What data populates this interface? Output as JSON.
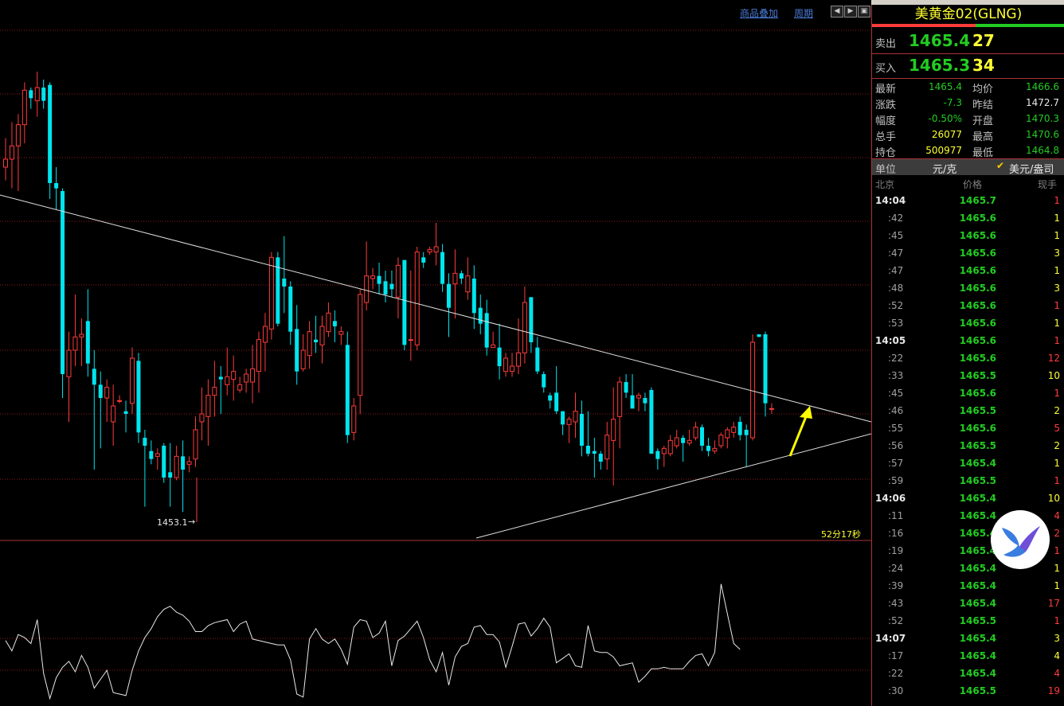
{
  "toolbar": {
    "overlay_label": "商品叠加",
    "period_label": "周期"
  },
  "chart": {
    "low_label": "1453.1",
    "countdown": "52分17秒"
  },
  "quote": {
    "title": "美黄金02(GLNG)",
    "sell_label": "卖出",
    "sell_price": "1465.4",
    "sell_qty": "27",
    "buy_label": "买入",
    "buy_price": "1465.3",
    "buy_qty": "34",
    "rows": [
      {
        "l1": "最新",
        "v1": "1465.4",
        "l2": "均价",
        "v2": "1466.6"
      },
      {
        "l1": "涨跌",
        "v1": "-7.3",
        "l2": "昨结",
        "v2": "1472.7"
      },
      {
        "l1": "幅度",
        "v1": "-0.50%",
        "l2": "开盘",
        "v2": "1470.3"
      },
      {
        "l1": "总手",
        "v1": "26077",
        "l2": "最高",
        "v2": "1470.6"
      },
      {
        "l1": "持仓",
        "v1": "500977",
        "l2": "最低",
        "v2": "1464.8"
      }
    ],
    "unit_label": "单位",
    "unit_value": "元/克",
    "unit_alt": "美元/盎司",
    "col_time": "北京",
    "col_price": "价格",
    "col_vol": "现手",
    "ticks": [
      {
        "t": "14:04",
        "p": "1465.7",
        "v": "1",
        "vc": "red",
        "major": true
      },
      {
        "t": ":42",
        "p": "1465.6",
        "v": "1",
        "vc": "yellow"
      },
      {
        "t": ":45",
        "p": "1465.6",
        "v": "1",
        "vc": "yellow"
      },
      {
        "t": ":47",
        "p": "1465.6",
        "v": "3",
        "vc": "yellow"
      },
      {
        "t": ":47",
        "p": "1465.6",
        "v": "1",
        "vc": "yellow"
      },
      {
        "t": ":48",
        "p": "1465.6",
        "v": "3",
        "vc": "yellow"
      },
      {
        "t": ":52",
        "p": "1465.6",
        "v": "1",
        "vc": "red"
      },
      {
        "t": ":53",
        "p": "1465.6",
        "v": "1",
        "vc": "yellow"
      },
      {
        "t": "14:05",
        "p": "1465.6",
        "v": "1",
        "vc": "red",
        "major": true
      },
      {
        "t": ":22",
        "p": "1465.6",
        "v": "12",
        "vc": "red"
      },
      {
        "t": ":33",
        "p": "1465.5",
        "v": "10",
        "vc": "yellow"
      },
      {
        "t": ":45",
        "p": "1465.6",
        "v": "1",
        "vc": "red"
      },
      {
        "t": ":46",
        "p": "1465.5",
        "v": "2",
        "vc": "yellow"
      },
      {
        "t": ":55",
        "p": "1465.6",
        "v": "5",
        "vc": "red"
      },
      {
        "t": ":56",
        "p": "1465.5",
        "v": "2",
        "vc": "yellow"
      },
      {
        "t": ":57",
        "p": "1465.4",
        "v": "1",
        "vc": "yellow"
      },
      {
        "t": ":59",
        "p": "1465.5",
        "v": "1",
        "vc": "red"
      },
      {
        "t": "14:06",
        "p": "1465.4",
        "v": "10",
        "vc": "yellow",
        "major": true
      },
      {
        "t": ":11",
        "p": "1465.4",
        "v": "4",
        "vc": "red"
      },
      {
        "t": ":16",
        "p": "1465.4",
        "v": "2",
        "vc": "red"
      },
      {
        "t": ":19",
        "p": "1465.4",
        "v": "1",
        "vc": "red"
      },
      {
        "t": ":24",
        "p": "1465.4",
        "v": "1",
        "vc": "yellow"
      },
      {
        "t": ":39",
        "p": "1465.4",
        "v": "1",
        "vc": "yellow"
      },
      {
        "t": ":43",
        "p": "1465.4",
        "v": "17",
        "vc": "red"
      },
      {
        "t": ":52",
        "p": "1465.5",
        "v": "1",
        "vc": "red"
      },
      {
        "t": "14:07",
        "p": "1465.4",
        "v": "3",
        "vc": "yellow",
        "major": true
      },
      {
        "t": ":17",
        "p": "1465.4",
        "v": "4",
        "vc": "yellow"
      },
      {
        "t": ":22",
        "p": "1465.4",
        "v": "4",
        "vc": "red"
      },
      {
        "t": ":30",
        "p": "1465.5",
        "v": "19",
        "vc": "red"
      }
    ]
  },
  "colors": {
    "up": "#ff3b3b",
    "down": "#00e5ee",
    "quote_green": "#22cc22",
    "quote_yellow": "#ffff33",
    "grid": "#8b1a1a"
  },
  "candles": [
    [
      1466.1,
      1467.2,
      1465.6,
      1466.4
    ],
    [
      1466.4,
      1467.8,
      1465.3,
      1466.9
    ],
    [
      1466.9,
      1468.1,
      1465.2,
      1467.7
    ],
    [
      1467.7,
      1469.3,
      1467.0,
      1469.0
    ],
    [
      1469.0,
      1469.1,
      1468.3,
      1468.7
    ],
    [
      1468.6,
      1469.7,
      1468.0,
      1469.1
    ],
    [
      1469.1,
      1469.4,
      1468.3,
      1468.6
    ],
    [
      1469.2,
      1469.3,
      1464.9,
      1465.5
    ],
    [
      1465.5,
      1466.1,
      1464.5,
      1465.3
    ],
    [
      1465.2,
      1465.3,
      1457.4,
      1458.3
    ],
    [
      1458.2,
      1459.9,
      1456.5,
      1459.2
    ],
    [
      1459.2,
      1461.3,
      1458.6,
      1459.7
    ],
    [
      1459.7,
      1460.4,
      1458.6,
      1459.8
    ],
    [
      1460.3,
      1461.5,
      1458.2,
      1458.7
    ],
    [
      1458.5,
      1459.2,
      1454.7,
      1457.9
    ],
    [
      1457.9,
      1458.4,
      1455.5,
      1457.4
    ],
    [
      1457.4,
      1458.1,
      1456.5,
      1457.8
    ],
    [
      1456.5,
      1457.9,
      1455.6,
      1457.1
    ],
    [
      1457.3,
      1457.5,
      1457.2,
      1457.3
    ],
    [
      1456.9,
      1457.3,
      1456.1,
      1456.8
    ],
    [
      1457.2,
      1459.3,
      1456.8,
      1458.9
    ],
    [
      1458.8,
      1459.1,
      1455.7,
      1456.1
    ],
    [
      1455.9,
      1456.2,
      1453.3,
      1455.6
    ],
    [
      1455.4,
      1455.8,
      1454.9,
      1455.1
    ],
    [
      1455.2,
      1455.5,
      1454.7,
      1455.3
    ],
    [
      1455.6,
      1455.7,
      1454.2,
      1454.4
    ],
    [
      1454.6,
      1455.7,
      1453.3,
      1454.4
    ],
    [
      1454.4,
      1455.6,
      1454.3,
      1455.2
    ],
    [
      1455.2,
      1455.8,
      1453.1,
      1454.7
    ],
    [
      1454.9,
      1455.2,
      1454.6,
      1455.0
    ],
    [
      1455.1,
      1456.7,
      1454.8,
      1456.2
    ],
    [
      1456.5,
      1457.8,
      1455.8,
      1456.8
    ],
    [
      1456.7,
      1458.1,
      1455.6,
      1457.5
    ],
    [
      1457.5,
      1458.8,
      1456.7,
      1457.8
    ],
    [
      1458.2,
      1458.6,
      1456.8,
      1458.1
    ],
    [
      1457.9,
      1459.3,
      1457.5,
      1458.2
    ],
    [
      1458.1,
      1459.0,
      1457.3,
      1458.4
    ],
    [
      1457.7,
      1458.2,
      1457.6,
      1457.9
    ],
    [
      1458.0,
      1458.5,
      1457.6,
      1458.3
    ],
    [
      1458.0,
      1459.4,
      1457.2,
      1458.5
    ],
    [
      1458.4,
      1459.9,
      1457.6,
      1459.6
    ],
    [
      1459.5,
      1460.6,
      1458.4,
      1460.1
    ],
    [
      1460.0,
      1462.9,
      1459.6,
      1462.7
    ],
    [
      1462.7,
      1462.9,
      1460.1,
      1460.2
    ],
    [
      1461.9,
      1463.5,
      1460.6,
      1461.6
    ],
    [
      1461.6,
      1461.8,
      1459.4,
      1459.9
    ],
    [
      1460.0,
      1460.9,
      1457.9,
      1458.4
    ],
    [
      1458.5,
      1459.8,
      1458.4,
      1459.2
    ],
    [
      1459.0,
      1460.3,
      1458.5,
      1459.9
    ],
    [
      1459.6,
      1460.5,
      1459.1,
      1459.5
    ],
    [
      1459.4,
      1460.5,
      1458.7,
      1460.1
    ],
    [
      1459.9,
      1461.0,
      1459.7,
      1460.6
    ],
    [
      1460.3,
      1460.7,
      1459.5,
      1460.1
    ],
    [
      1459.8,
      1460.1,
      1459.4,
      1459.9
    ],
    [
      1459.4,
      1459.9,
      1455.7,
      1456.0
    ],
    [
      1456.1,
      1457.4,
      1455.8,
      1457.1
    ],
    [
      1457.5,
      1461.5,
      1456.8,
      1461.3
    ],
    [
      1461.0,
      1463.3,
      1460.7,
      1462.0
    ],
    [
      1461.9,
      1462.3,
      1461.5,
      1462.0
    ],
    [
      1462.0,
      1462.5,
      1461.3,
      1461.7
    ],
    [
      1461.8,
      1462.2,
      1461.0,
      1461.3
    ],
    [
      1461.7,
      1462.2,
      1461.2,
      1461.5
    ],
    [
      1461.2,
      1462.7,
      1460.4,
      1462.4
    ],
    [
      1462.6,
      1462.6,
      1459.2,
      1459.4
    ],
    [
      1459.6,
      1462.2,
      1458.8,
      1459.6
    ],
    [
      1459.4,
      1463.1,
      1459.2,
      1462.9
    ],
    [
      1462.7,
      1462.9,
      1462.3,
      1462.5
    ],
    [
      1462.9,
      1463.1,
      1462.8,
      1463.0
    ],
    [
      1462.9,
      1464.0,
      1462.4,
      1463.1
    ],
    [
      1462.9,
      1463.2,
      1461.4,
      1461.7
    ],
    [
      1461.7,
      1462.1,
      1459.7,
      1460.8
    ],
    [
      1461.7,
      1463.0,
      1460.4,
      1462.1
    ],
    [
      1462.1,
      1462.2,
      1461.7,
      1461.9
    ],
    [
      1461.4,
      1462.7,
      1461.1,
      1462.0
    ],
    [
      1461.9,
      1462.4,
      1460.0,
      1460.6
    ],
    [
      1460.8,
      1461.3,
      1459.8,
      1460.2
    ],
    [
      1460.6,
      1461.1,
      1459.0,
      1459.3
    ],
    [
      1459.3,
      1459.9,
      1459.3,
      1459.4
    ],
    [
      1459.3,
      1460.2,
      1458.1,
      1458.6
    ],
    [
      1458.4,
      1459.1,
      1458.2,
      1458.9
    ],
    [
      1458.4,
      1459.1,
      1458.2,
      1458.6
    ],
    [
      1458.6,
      1460.4,
      1458.3,
      1459.1
    ],
    [
      1459.1,
      1461.6,
      1458.7,
      1461.0
    ],
    [
      1461.2,
      1461.2,
      1459.1,
      1459.5
    ],
    [
      1459.3,
      1459.7,
      1458.3,
      1458.4
    ],
    [
      1458.3,
      1458.4,
      1457.6,
      1457.8
    ],
    [
      1457.5,
      1457.6,
      1457.0,
      1457.3
    ],
    [
      1457.6,
      1458.6,
      1456.8,
      1456.9
    ],
    [
      1456.9,
      1456.9,
      1456.0,
      1456.4
    ],
    [
      1456.4,
      1456.7,
      1455.7,
      1456.6
    ],
    [
      1456.5,
      1457.6,
      1455.9,
      1456.9
    ],
    [
      1456.8,
      1457.3,
      1455.2,
      1455.6
    ],
    [
      1455.6,
      1456.9,
      1455.2,
      1455.3
    ],
    [
      1455.4,
      1455.9,
      1454.4,
      1455.3
    ],
    [
      1455.3,
      1455.4,
      1454.7,
      1455.0
    ],
    [
      1455.1,
      1456.5,
      1454.7,
      1456.0
    ],
    [
      1455.8,
      1457.8,
      1454.1,
      1456.6
    ],
    [
      1456.7,
      1458.2,
      1455.5,
      1458.0
    ],
    [
      1458.0,
      1458.3,
      1457.4,
      1457.6
    ],
    [
      1457.5,
      1458.3,
      1457.3,
      1457.0
    ],
    [
      1457.4,
      1457.6,
      1456.9,
      1457.5
    ],
    [
      1457.4,
      1457.6,
      1456.9,
      1457.2
    ],
    [
      1457.7,
      1457.8,
      1457.0,
      1455.3
    ],
    [
      1455.4,
      1455.5,
      1454.7,
      1455.1
    ],
    [
      1455.3,
      1455.6,
      1454.8,
      1455.5
    ],
    [
      1455.3,
      1456.0,
      1455.2,
      1455.8
    ],
    [
      1455.6,
      1456.2,
      1455.5,
      1455.9
    ],
    [
      1455.9,
      1456.0,
      1455.0,
      1455.7
    ],
    [
      1455.7,
      1456.2,
      1455.6,
      1455.8
    ],
    [
      1455.9,
      1456.5,
      1455.8,
      1456.3
    ],
    [
      1456.3,
      1456.4,
      1455.4,
      1455.6
    ],
    [
      1455.6,
      1455.9,
      1455.2,
      1455.4
    ],
    [
      1455.4,
      1455.8,
      1455.3,
      1455.5
    ],
    [
      1455.6,
      1456.1,
      1455.5,
      1456.0
    ],
    [
      1455.9,
      1456.3,
      1455.5,
      1456.2
    ],
    [
      1456.1,
      1456.5,
      1455.9,
      1456.3
    ],
    [
      1456.5,
      1456.7,
      1455.8,
      1456.0
    ],
    [
      1456.2,
      1456.4,
      1454.8,
      1456.0
    ],
    [
      1455.9,
      1459.8,
      1455.8,
      1459.5
    ],
    [
      1459.8,
      1459.8,
      1459.7,
      1459.7
    ],
    [
      1459.8,
      1459.9,
      1456.7,
      1457.2
    ],
    [
      1457.0,
      1457.2,
      1456.8,
      1457.0
    ]
  ],
  "oscillator": [
    44,
    37,
    48,
    46,
    42,
    58,
    22,
    5,
    19,
    26,
    30,
    23,
    34,
    26,
    12,
    18,
    24,
    9,
    8,
    7,
    24,
    37,
    46,
    52,
    60,
    65,
    67,
    63,
    61,
    57,
    50,
    50,
    54,
    56,
    57,
    58,
    50,
    55,
    57,
    45,
    44,
    43,
    42,
    41,
    41,
    31,
    8,
    6,
    45,
    52,
    45,
    42,
    45,
    38,
    28,
    53,
    58,
    57,
    46,
    49,
    57,
    27,
    44,
    47,
    52,
    57,
    46,
    31,
    23,
    36,
    14,
    33,
    40,
    42,
    53,
    54,
    48,
    48,
    43,
    26,
    40,
    55,
    56,
    47,
    52,
    59,
    53,
    29,
    32,
    35,
    27,
    26,
    54,
    37,
    36,
    36,
    33,
    27,
    28,
    29,
    16,
    20,
    25,
    25,
    26,
    25,
    25,
    25,
    30,
    34,
    35,
    27,
    36,
    82,
    62,
    42,
    38
  ],
  "oscillator_range": [
    0,
    100
  ]
}
